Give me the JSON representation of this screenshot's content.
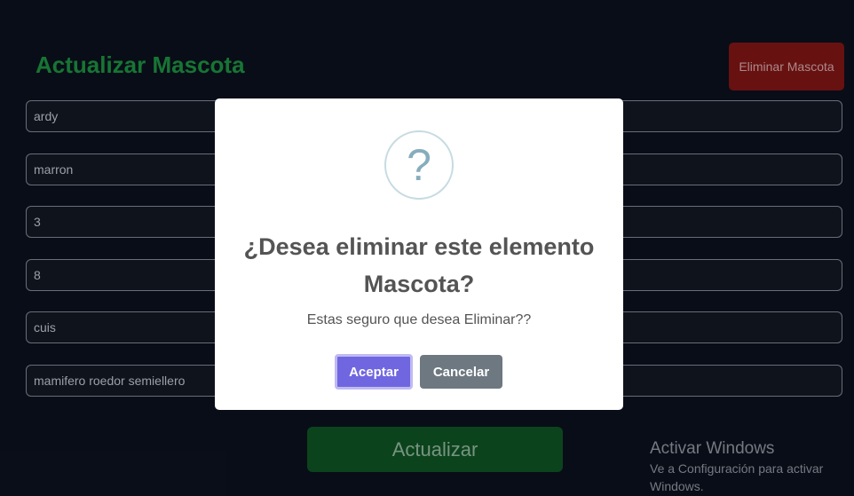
{
  "page": {
    "title": "Actualizar Mascota",
    "delete_label": "Eliminar Mascota"
  },
  "form": {
    "fields": [
      {
        "value": "ardy"
      },
      {
        "value": "marron"
      },
      {
        "value": "3"
      },
      {
        "value": "8"
      },
      {
        "value": "cuis"
      },
      {
        "value": "mamifero roedor semiellero"
      }
    ],
    "submit_label": "Actualizar"
  },
  "dialog": {
    "icon": "question-icon",
    "icon_glyph": "?",
    "title": "¿Desea eliminar este elemento Mascota?",
    "text": "Estas seguro que desea Eliminar??",
    "confirm_label": "Aceptar",
    "cancel_label": "Cancelar"
  },
  "watermark": {
    "title": "Activar Windows",
    "subtitle": "Ve a Configuración para activar Windows."
  },
  "colors": {
    "background": "#0b101c",
    "title": "#1c8a3e",
    "danger": "#7a1414",
    "confirm": "#7066e0",
    "cancel": "#6e7881",
    "update": "#0d4f23"
  }
}
